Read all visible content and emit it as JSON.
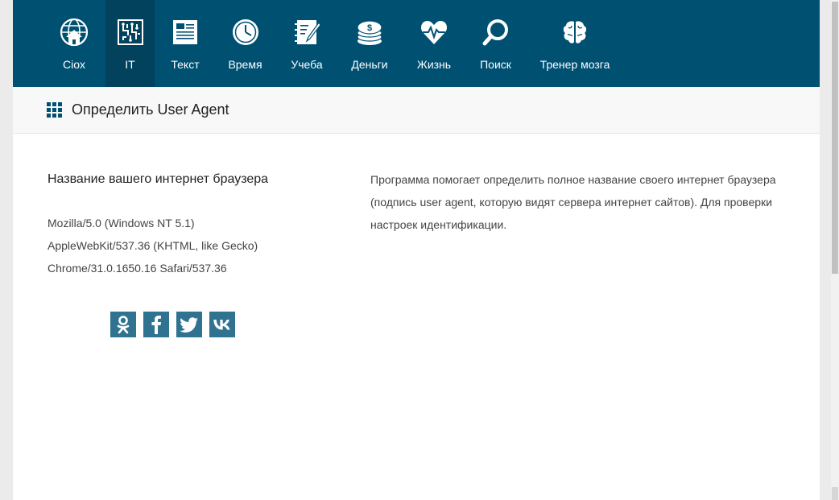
{
  "nav": {
    "items": [
      {
        "label": "Ciox",
        "icon": "globe-home-icon"
      },
      {
        "label": "IT",
        "icon": "circuit-chip-icon"
      },
      {
        "label": "Текст",
        "icon": "text-document-icon"
      },
      {
        "label": "Время",
        "icon": "clock-icon"
      },
      {
        "label": "Учеба",
        "icon": "notebook-pen-icon"
      },
      {
        "label": "Деньги",
        "icon": "coin-stack-icon"
      },
      {
        "label": "Жизнь",
        "icon": "heart-pulse-icon"
      },
      {
        "label": "Поиск",
        "icon": "magnifier-icon"
      },
      {
        "label": "Тренер мозга",
        "icon": "brain-icon"
      }
    ],
    "active": "IT"
  },
  "subheader": {
    "title": "Определить User Agent",
    "icon": "grid-icon"
  },
  "browser_section": {
    "title": "Название вашего интернет браузера",
    "ua_lines": [
      "Mozilla/5.0 (Windows NT 5.1)",
      "AppleWebKit/537.36 (KHTML, like Gecko)",
      "Chrome/31.0.1650.16 Safari/537.36"
    ]
  },
  "description": "Программа помогает определить полное название своего интернет браузера (подпись user agent, которую видят сервера интернет сайтов). Для проверки настроек идентификации.",
  "social": [
    {
      "name": "odnoklassniki-icon"
    },
    {
      "name": "facebook-icon"
    },
    {
      "name": "twitter-icon"
    },
    {
      "name": "vk-icon"
    }
  ],
  "colors": {
    "nav_bg": "#005072",
    "nav_active": "#02425d",
    "social_bg": "#2f7390"
  }
}
